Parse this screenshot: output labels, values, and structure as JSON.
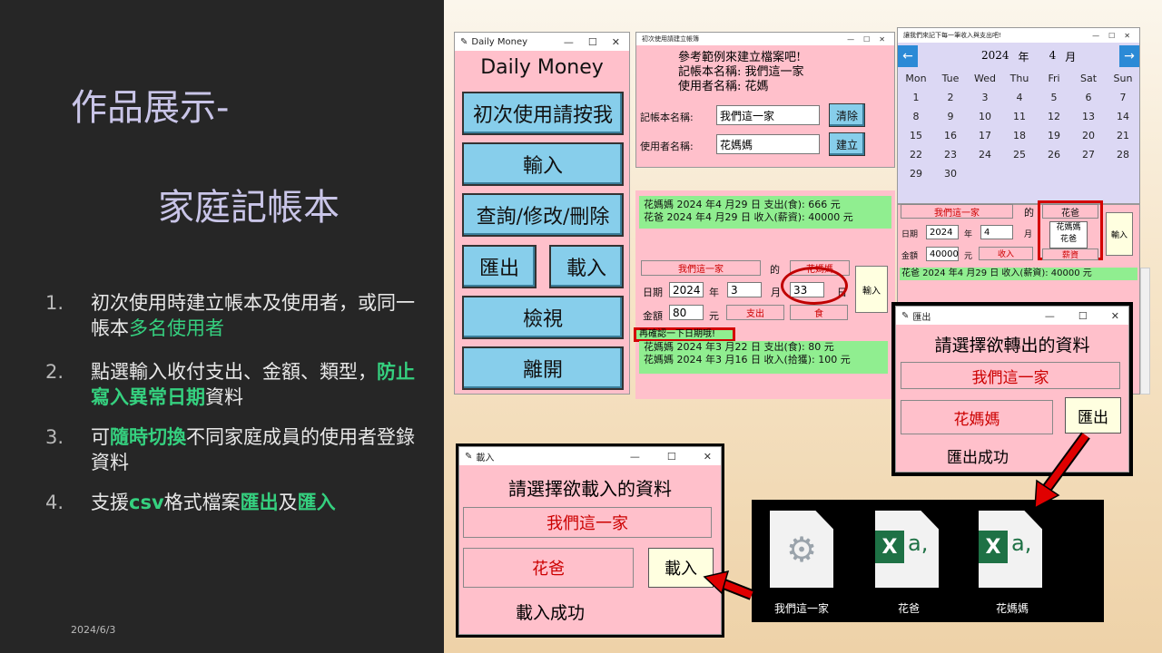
{
  "slide": {
    "title_line1": "作品展示-",
    "title_line2": "家庭記帳本",
    "date": "2024/6/3",
    "items": [
      {
        "num": "1.",
        "a": "初次使用時建立帳本及使用者，或同一帳本",
        "b": "多名使用者",
        "c": ""
      },
      {
        "num": "2.",
        "a": "點選輸入收付支出、金額、類型，",
        "b": "防止寫入異常日期",
        "c": "資料"
      },
      {
        "num": "3.",
        "a": "可",
        "b": "隨時切換",
        "c": "不同家庭成員的使用者登錄資料"
      },
      {
        "num": "4.",
        "a": "支援",
        "b": "csv",
        "c": "格式檔案",
        "d": "匯出",
        "e": "及",
        "f": "匯入"
      }
    ]
  },
  "main_win": {
    "title": "Daily Money",
    "heading": "Daily Money",
    "buttons": [
      "初次使用請按我",
      "輸入",
      "查詢/修改/刪除",
      "匯出",
      "載入",
      "檢視",
      "離開"
    ]
  },
  "setup_win": {
    "title": "初次使用請建立帳簿",
    "lines": [
      "參考範例來建立檔案吧!",
      "記帳本名稱: 我們這一家",
      "使用者名稱: 花媽"
    ],
    "book_label": "記帳本名稱:",
    "book_value": "我們這一家",
    "clear": "清除",
    "user_label": "使用者名稱:",
    "user_value": "花媽媽",
    "create": "建立"
  },
  "records1": [
    "花媽媽 2024 年4 月29 日 支出(食): 666 元",
    "花爸 2024 年4 月29 日 收入(薪資): 40000 元"
  ],
  "input_win": {
    "book": "我們這一家",
    "of": "的",
    "user": "花媽媽",
    "date_label": "日期",
    "year": "2024",
    "y": "年",
    "month": "3",
    "m": "月",
    "day": "33",
    "d": "日",
    "amount_label": "金額",
    "amount": "80",
    "yuan": "元",
    "type": "支出",
    "cat": "食",
    "submit": "輸入",
    "warn": "再確認一下日期哦!",
    "records": [
      "花媽媽 2024 年3 月22 日 支出(食): 80 元",
      "花媽媽 2024 年3 月16 日 收入(拾獲): 100 元"
    ]
  },
  "cal_win": {
    "title": "讓我們來記下每一筆收入與支出吧!",
    "prev": "←",
    "next": "→",
    "year": "2024",
    "y": "年",
    "month": "4",
    "m": "月",
    "days": [
      "Mon",
      "Tue",
      "Wed",
      "Thu",
      "Fri",
      "Sat",
      "Sun"
    ],
    "dates": [
      "",
      "",
      "",
      "",
      "",
      "",
      "",
      "1",
      "2",
      "3",
      "4",
      "5",
      "6",
      "7",
      "8",
      "9",
      "10",
      "11",
      "12",
      "13",
      "14",
      "15",
      "16",
      "17",
      "18",
      "19",
      "20",
      "21",
      "22",
      "23",
      "24",
      "25",
      "26",
      "27",
      "28",
      "29",
      "30",
      "",
      "",
      "",
      "",
      ""
    ],
    "book": "我們這一家",
    "of": "的",
    "user": "花爸",
    "opt1": "花媽媽",
    "opt2": "花爸",
    "submit": "輸入",
    "date_label": "日期",
    "year_v": "2024",
    "month_v": "4",
    "amount_label": "金額",
    "amount": "40000",
    "yuan": "元",
    "type": "收入",
    "cat": "薪資",
    "record": "花爸 2024 年4 月29 日 收入(薪資): 40000 元"
  },
  "export_win": {
    "title": "匯出",
    "heading": "請選擇欲轉出的資料",
    "book": "我們這一家",
    "user": "花媽媽",
    "btn": "匯出",
    "done": "匯出成功"
  },
  "import_win": {
    "title": "載入",
    "heading": "請選擇欲載入的資料",
    "book": "我們這一家",
    "user": "花爸",
    "btn": "載入",
    "done": "載入成功"
  },
  "files": [
    {
      "name": "我們這一家",
      "icon": "settings-file-icon"
    },
    {
      "name": "花爸",
      "icon": "excel-file-icon",
      "glyph": "X",
      "suffix": "a,"
    },
    {
      "name": "花媽媽",
      "icon": "excel-file-icon",
      "glyph": "X",
      "suffix": "a,"
    }
  ],
  "colors": {
    "pink": "#ffc0cb",
    "skyblue": "#87ceeb",
    "green": "#90ee90",
    "red": "#d40000",
    "accent": "#35d07f"
  }
}
